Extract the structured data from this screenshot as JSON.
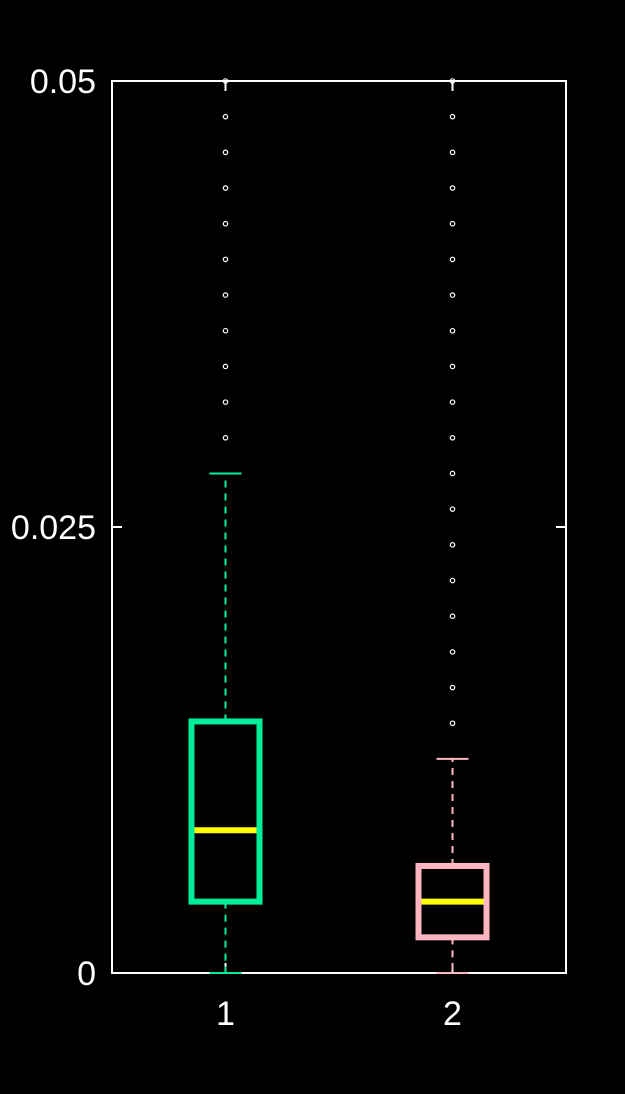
{
  "chart_data": {
    "type": "box",
    "title": "",
    "xlabel": "",
    "ylabel": "",
    "ylim": [
      0,
      0.05
    ],
    "y_ticks": [
      {
        "value": 0,
        "label": "0"
      },
      {
        "value": 0.025,
        "label": "0.025"
      },
      {
        "value": 0.05,
        "label": "0.05"
      }
    ],
    "categories": [
      "1",
      "2"
    ],
    "grid": false,
    "legend": "none",
    "colors": {
      "background": "#000000",
      "axes": "#ffffff",
      "median": "#ffff00",
      "outliers": "#ffffff"
    },
    "boxes": [
      {
        "category": "1",
        "color": "#00ee99",
        "whisker_low": 0,
        "q1": 0.004,
        "median": 0.008,
        "q3": 0.0141,
        "whisker_high": 0.028,
        "outliers": [
          0.03,
          0.032,
          0.034,
          0.036,
          0.038,
          0.04,
          0.042,
          0.044,
          0.046,
          0.048,
          0.05
        ]
      },
      {
        "category": "2",
        "color": "#ffb6c1",
        "whisker_low": 0,
        "q1": 0.002,
        "median": 0.004,
        "q3": 0.006,
        "whisker_high": 0.012,
        "outliers": [
          0.014,
          0.016,
          0.018,
          0.02,
          0.022,
          0.024,
          0.026,
          0.028,
          0.03,
          0.032,
          0.034,
          0.036,
          0.038,
          0.04,
          0.042,
          0.044,
          0.046,
          0.048,
          0.05
        ]
      }
    ]
  }
}
